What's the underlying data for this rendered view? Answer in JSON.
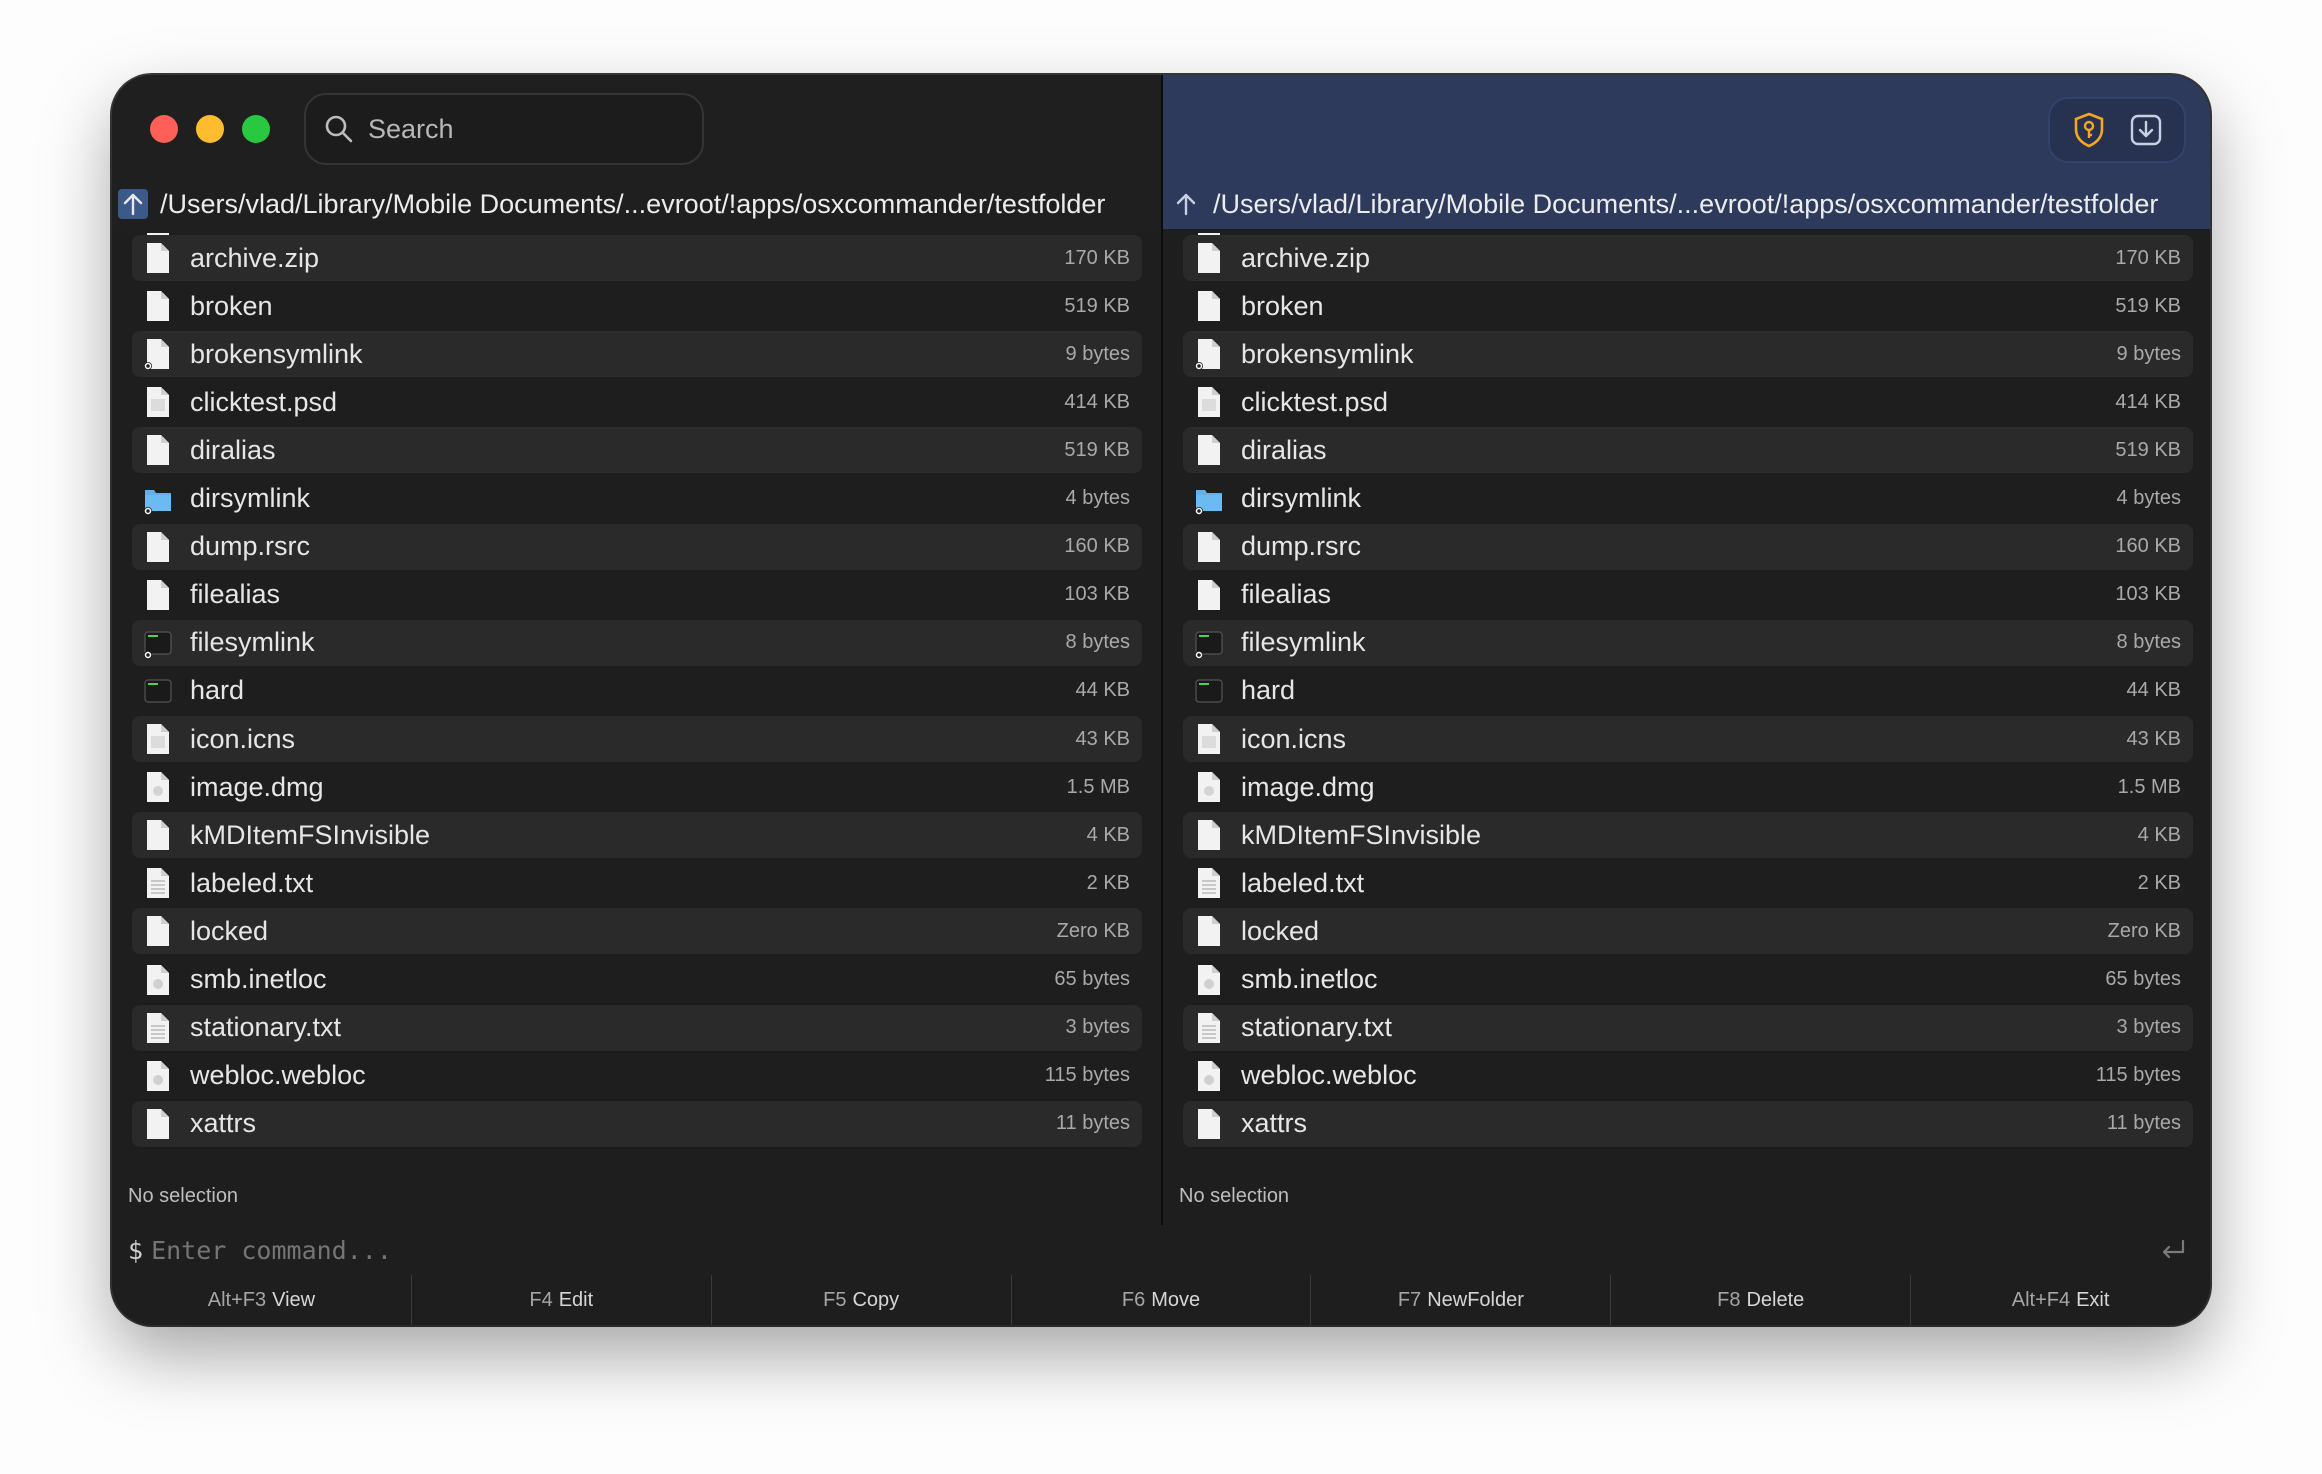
{
  "window": {
    "search_placeholder": "Search"
  },
  "left_pane": {
    "path": "/Users/vlad/Library/Mobile Documents/...evroot/!apps/osxcommander/testfolder",
    "status": "No selection"
  },
  "right_pane": {
    "path": "/Users/vlad/Library/Mobile Documents/...evroot/!apps/osxcommander/testfolder",
    "status": "No selection",
    "toolbar": [
      "shield-key-icon",
      "download-box-icon"
    ]
  },
  "files": [
    {
      "name": "archive.zip",
      "size": "170 KB",
      "icon": "doc"
    },
    {
      "name": "broken",
      "size": "519 KB",
      "icon": "doc"
    },
    {
      "name": "brokensymlink",
      "size": "9 bytes",
      "icon": "doc-link"
    },
    {
      "name": "clicktest.psd",
      "size": "414 KB",
      "icon": "doc-lines"
    },
    {
      "name": "diralias",
      "size": "519 KB",
      "icon": "doc"
    },
    {
      "name": "dirsymlink",
      "size": "4 bytes",
      "icon": "folder-link"
    },
    {
      "name": "dump.rsrc",
      "size": "160 KB",
      "icon": "doc"
    },
    {
      "name": "filealias",
      "size": "103 KB",
      "icon": "doc"
    },
    {
      "name": "filesymlink",
      "size": "8 bytes",
      "icon": "exec-link"
    },
    {
      "name": "hard",
      "size": "44 KB",
      "icon": "exec"
    },
    {
      "name": "icon.icns",
      "size": "43 KB",
      "icon": "doc-lines"
    },
    {
      "name": "image.dmg",
      "size": "1.5 MB",
      "icon": "doc-disk"
    },
    {
      "name": "kMDItemFSInvisible",
      "size": "4 KB",
      "icon": "doc"
    },
    {
      "name": "labeled.txt",
      "size": "2 KB",
      "icon": "doc-text"
    },
    {
      "name": "locked",
      "size": "Zero KB",
      "icon": "doc"
    },
    {
      "name": "smb.inetloc",
      "size": "65 bytes",
      "icon": "doc-globe"
    },
    {
      "name": "stationary.txt",
      "size": "3 bytes",
      "icon": "doc-text"
    },
    {
      "name": "webloc.webloc",
      "size": "115 bytes",
      "icon": "doc-globe"
    },
    {
      "name": "xattrs",
      "size": "11 bytes",
      "icon": "doc"
    }
  ],
  "command": {
    "prompt": "$",
    "placeholder": "Enter command..."
  },
  "fkeys": [
    {
      "key": "Alt+F3",
      "label": "View"
    },
    {
      "key": "F4",
      "label": "Edit"
    },
    {
      "key": "F5",
      "label": "Copy"
    },
    {
      "key": "F6",
      "label": "Move"
    },
    {
      "key": "F7",
      "label": "NewFolder"
    },
    {
      "key": "F8",
      "label": "Delete"
    },
    {
      "key": "Alt+F4",
      "label": "Exit"
    }
  ],
  "colors": {
    "right_header": "#2d3a5c",
    "row_alt": "#2a2a2a",
    "folder": "#5fb0ec",
    "shield": "#f5a623"
  }
}
